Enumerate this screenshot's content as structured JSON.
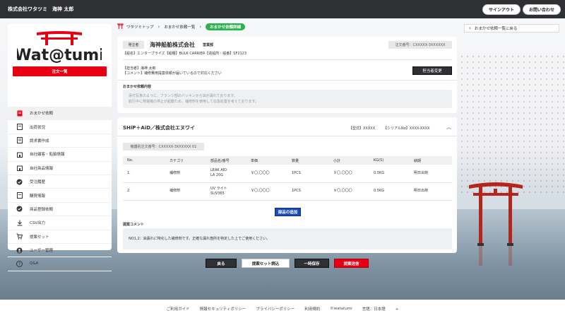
{
  "header": {
    "user_label": "株式会社ワタツミ　海神 太郎",
    "signout_label": "サインアウト",
    "contact_label": "お問い合わせ"
  },
  "colors": {
    "accent_red": "#e60012",
    "accent_green": "#2bb24c",
    "accent_blue": "#1e4bb5",
    "dark": "#2f3034"
  },
  "sidebar": {
    "logo_text": "Wat@tumi",
    "list_button": "注文一覧",
    "items": [
      {
        "label": "おまかせ依頼",
        "icon": "document-red-icon",
        "active": true
      },
      {
        "label": "出荷状況",
        "icon": "document-icon",
        "active": false
      },
      {
        "label": "請求書作成",
        "icon": "invoice-icon",
        "active": false
      },
      {
        "label": "自社顧客・船舶情報",
        "icon": "building-icon",
        "active": false
      },
      {
        "label": "自社商品情報",
        "icon": "building-icon",
        "active": false
      },
      {
        "label": "受注履歴",
        "icon": "check-circle-icon",
        "active": false
      },
      {
        "label": "購買情報",
        "icon": "document-icon",
        "active": false
      },
      {
        "label": "商品登録依頼",
        "icon": "check-circle-icon",
        "active": false
      },
      {
        "label": "CSV出力",
        "icon": "download-icon",
        "active": false
      },
      {
        "label": "提案セット",
        "icon": "cart-icon",
        "active": false
      },
      {
        "label": "ユーザー管理",
        "icon": "person-icon",
        "active": false
      },
      {
        "label": "Q&A",
        "icon": "question-icon",
        "active": false
      }
    ]
  },
  "breadcrumb": {
    "home": "ワタツミトップ",
    "list": "おまかせ依頼一覧",
    "current": "おまかせ依頼詳細"
  },
  "back_link": "おまかせ依頼一覧に戻る",
  "order": {
    "requester_tag": "発注者",
    "company": "海神船舶株式会社",
    "dept": "営業部",
    "order_no": "注文番号：CXXXXX-3XXXXXX",
    "vessel_line": "【船名】エンタープライズ【船種】BULK CARRIER【造船所・船番】SF2123",
    "contact_person": "【担当者】海神 太郎",
    "comment": "【コメント】補修費用提案依頼が届いているので対応ください",
    "change_button": "担当者変更",
    "memo_heading": "おまかせ依頼内容",
    "memo_line1": "添付写真のように、フランジ部のパッキンから油が漏れております。",
    "memo_line2": "航行中に発電機の停止が起動ため、補修剤を使用して応急処置を考えております。"
  },
  "proposal": {
    "supplier": "SHiP＋AiD／株式会社エヌワイ",
    "model": "【型式】XXXXX",
    "serial": "【シリアルNo】XXXX-XXXX",
    "machine_order_no": "機器別注文番号：CXXXXX-3XXXXXX 01",
    "columns": [
      "No.",
      "カテゴリ",
      "部品名/番号",
      "単価",
      "数量",
      "小計",
      "KG(S)",
      "納期"
    ],
    "rows": [
      {
        "no": "1.",
        "category": "補修剤",
        "part_name": "LEAK AID",
        "part_no": "LA 20G",
        "unit_price": "￥〇,〇〇〇",
        "qty": "1PCS",
        "subtotal": "￥〇,〇〇〇",
        "kg": "0.5KG",
        "delivery": "明日出荷"
      },
      {
        "no": "2.",
        "category": "補修剤",
        "part_name": "UV ライト",
        "part_no": "SUV365",
        "unit_price": "￥〇,〇〇〇",
        "qty": "1PCS",
        "subtotal": "￥〇,〇〇〇",
        "kg": "0.5KG",
        "delivery": "明日出荷"
      }
    ],
    "add_part_button": "部品の追加",
    "comment_heading": "提案コメント",
    "comment_text": "NO1,2：油漏れに特化した補修剤です。正確な漏れ箇所を特定した上でご使用ください。"
  },
  "actions": {
    "back": "戻る",
    "load_set": "提案セット読込",
    "temp_save": "一時保存",
    "submit": "提案送信"
  },
  "footer": {
    "guide": "ご利用ガイド",
    "security": "情報セキュリティポリシー",
    "privacy": "プライバシーポリシー",
    "terms": "利用規約",
    "copyright": "©watatumi",
    "language": "言語：日本語",
    "lang_plus": "+"
  }
}
